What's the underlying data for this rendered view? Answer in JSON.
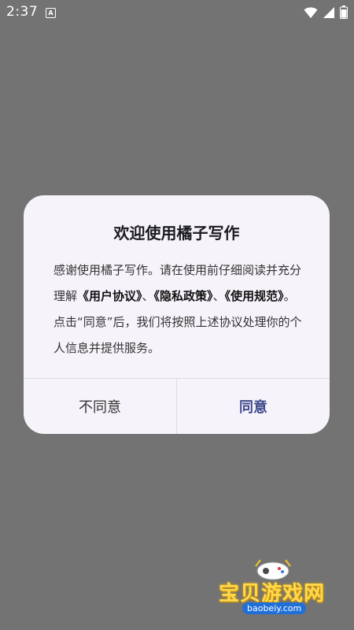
{
  "status_bar": {
    "time": "2:37",
    "notification_glyph": "A",
    "icons": [
      "wifi-icon",
      "signal-icon",
      "battery-icon"
    ]
  },
  "dialog": {
    "title": "欢迎使用橘子写作",
    "body_intro": "感谢使用橘子写作。请在使用前仔细阅读并充分理解",
    "link_user_agreement": "《用户协议》",
    "sep1": "、",
    "link_privacy_policy": "《隐私政策》",
    "sep2": "、",
    "link_usage_rules": "《使用规范》",
    "body_outro": "。点击“同意”后，我们将按照上述协议处理你的个人信息并提供服务。",
    "disagree_label": "不同意",
    "agree_label": "同意"
  },
  "watermark": {
    "text": "宝贝游戏网",
    "domain": "baobeiy.com"
  },
  "colors": {
    "overlay": "#737373",
    "dialog_bg": "#f7f3fa",
    "agree_text": "#3d4a8c"
  }
}
